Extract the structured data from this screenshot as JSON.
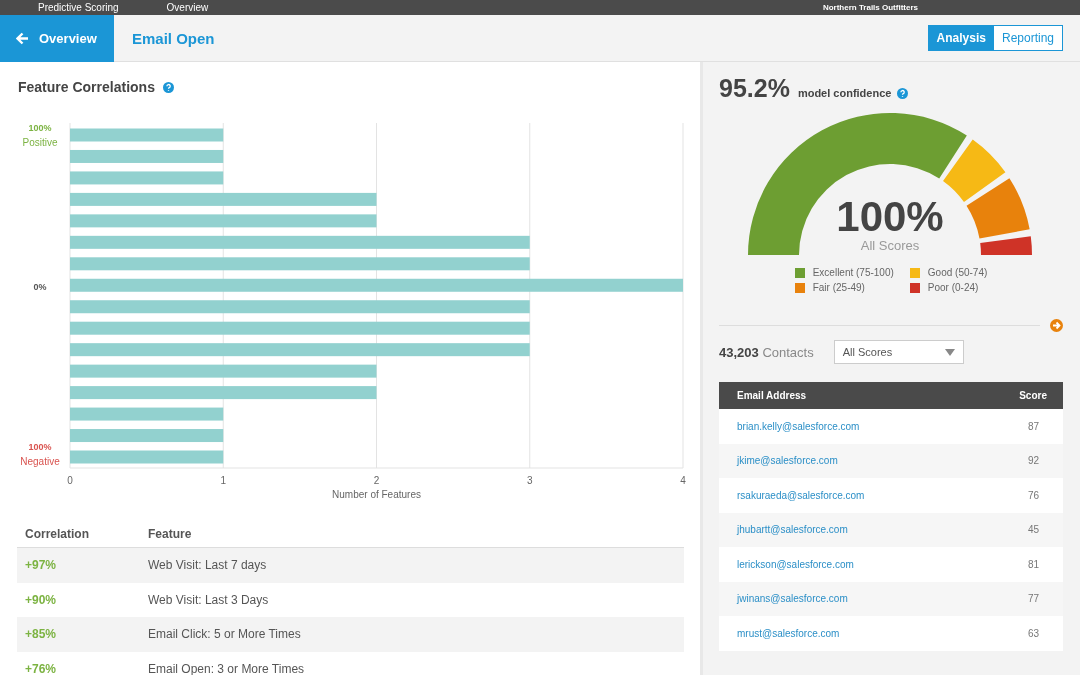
{
  "top_bar": {
    "app_title": "Predictive Scoring",
    "nav_link": "Overview",
    "org": "Northern Trails Outfitters"
  },
  "header": {
    "back_button": "Overview",
    "title": "Email Open",
    "view_tabs": [
      {
        "label": "Analysis",
        "selected": true
      },
      {
        "label": "Reporting",
        "selected": false
      }
    ]
  },
  "feature_correlations": {
    "title": "Feature Correlations",
    "axis_labels": [
      {
        "kind": "positive",
        "value": "100%",
        "caption": "Positive"
      },
      {
        "kind": "neutral",
        "value": "0%"
      },
      {
        "kind": "negative",
        "value": "100%",
        "caption": "Negative"
      }
    ],
    "chart_data": {
      "type": "bar",
      "orientation": "horizontal",
      "grid": true,
      "xlabel": "Number of Features",
      "xlim": [
        0,
        4
      ],
      "xticks": [
        0,
        1,
        2,
        3,
        4
      ],
      "values": [
        1,
        1,
        1,
        2,
        2,
        3,
        3,
        4,
        3,
        3,
        3,
        2,
        2,
        1,
        1,
        1
      ]
    },
    "table": {
      "columns": [
        "Correlation",
        "Feature"
      ],
      "rows": [
        {
          "correlation": "+97%",
          "feature": "Web Visit: Last 7 days"
        },
        {
          "correlation": "+90%",
          "feature": "Web Visit: Last 3 Days"
        },
        {
          "correlation": "+85%",
          "feature": "Email Click: 5 or More Times"
        },
        {
          "correlation": "+76%",
          "feature": "Email Open: 3 or More Times"
        }
      ]
    }
  },
  "model": {
    "confidence": "95.2%",
    "confidence_label": "model confidence",
    "gauge": {
      "value": "100%",
      "caption": "All Scores"
    },
    "legend": [
      {
        "label": "Excellent (75-100)",
        "color": "#6d9e32"
      },
      {
        "label": "Good (50-74)",
        "color": "#f6b915"
      },
      {
        "label": "Fair (25-49)",
        "color": "#e8820c"
      },
      {
        "label": "Poor (0-24)",
        "color": "#cf3327"
      }
    ],
    "contacts_count": "43,203",
    "contacts_label": "Contacts",
    "filter": "All Scores",
    "contacts_table": {
      "columns": [
        "Email Address",
        "Score"
      ],
      "rows": [
        {
          "email": "brian.kelly@salesforce.com",
          "score": "87"
        },
        {
          "email": "jkime@salesforce.com",
          "score": "92"
        },
        {
          "email": "rsakuraeda@salesforce.com",
          "score": "76"
        },
        {
          "email": "jhubartt@salesforce.com",
          "score": "45"
        },
        {
          "email": "lerickson@salesforce.com",
          "score": "81"
        },
        {
          "email": "jwinans@salesforce.com",
          "score": "77"
        },
        {
          "email": "mrust@salesforce.com",
          "score": "63"
        }
      ]
    }
  }
}
